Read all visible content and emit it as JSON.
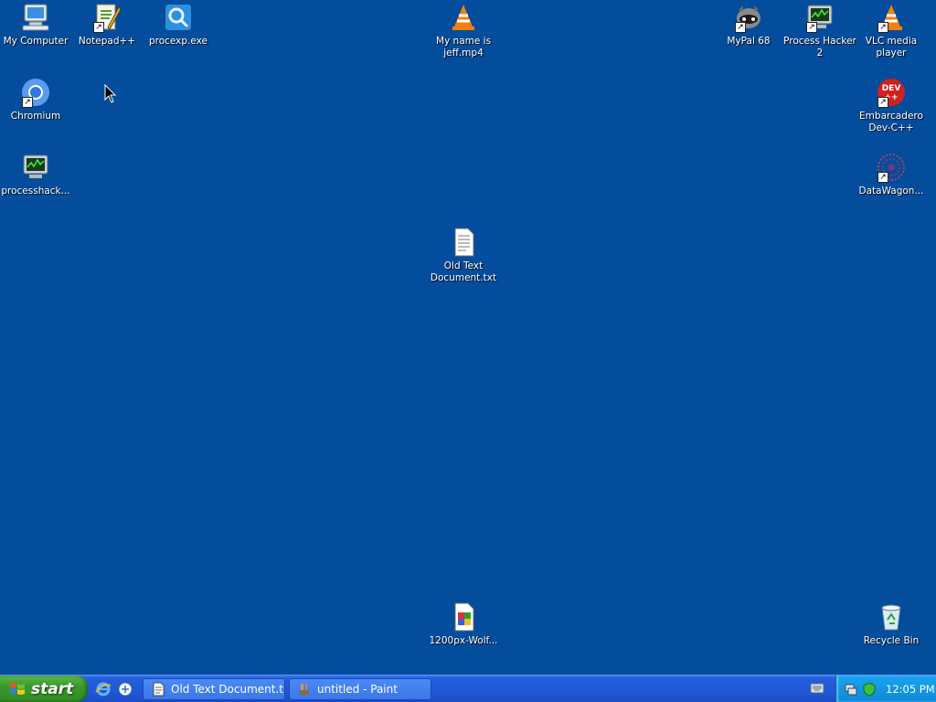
{
  "desktop": {
    "background": "#034d9c",
    "icons": [
      {
        "label": "My Computer",
        "icon": "my-computer-icon"
      },
      {
        "label": "Notepad++",
        "icon": "notepadpp-icon"
      },
      {
        "label": "procexp.exe",
        "icon": "procexp-icon"
      },
      {
        "label": "My name is\njeff.mp4",
        "icon": "vlc-icon"
      },
      {
        "label": "MyPal 68",
        "icon": "mypal-icon"
      },
      {
        "label": "Process Hacker\n2",
        "icon": "process-hacker-icon"
      },
      {
        "label": "VLC media\nplayer",
        "icon": "vlc-icon"
      },
      {
        "label": "Chromium",
        "icon": "chromium-icon"
      },
      {
        "label": "Embarcadero\nDev-C++",
        "icon": "devcpp-icon"
      },
      {
        "label": "processhack...",
        "icon": "process-hacker-icon"
      },
      {
        "label": "DataWagon...",
        "icon": "datawagon-icon"
      },
      {
        "label": "Old Text\nDocument.txt",
        "icon": "text-document-icon"
      },
      {
        "label": "1200px-Wolf...",
        "icon": "image-file-icon"
      },
      {
        "label": "Recycle Bin",
        "icon": "recycle-bin-icon"
      }
    ]
  },
  "taskbar": {
    "start_label": "start",
    "quicklaunch": [
      "internet-explorer-icon",
      "show-desktop-icon"
    ],
    "tasks": [
      {
        "label": "Old Text Document.t...",
        "icon": "notepad-icon"
      },
      {
        "label": "untitled - Paint",
        "icon": "paint-icon"
      }
    ],
    "tray": {
      "clock": "12:05 PM",
      "icons": [
        "network-icon",
        "security-icon",
        "keyboard-icon"
      ]
    }
  }
}
